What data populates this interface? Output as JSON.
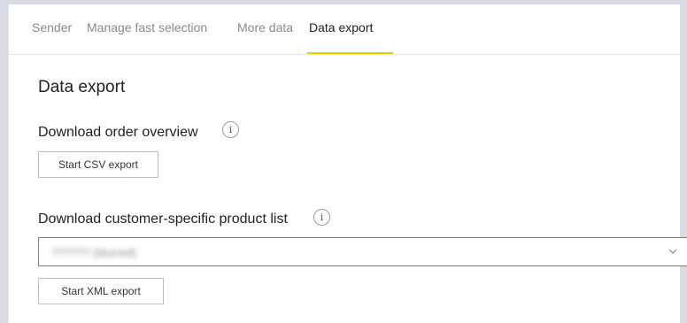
{
  "tabs": [
    {
      "label": "Sender",
      "active": false
    },
    {
      "label": "Manage fast selection",
      "active": false
    },
    {
      "label": "More data",
      "active": false
    },
    {
      "label": "Data export",
      "active": true
    }
  ],
  "page_title": "Data export",
  "order_overview": {
    "label": "Download order overview",
    "info_icon": "info-icon",
    "button_label": "Start CSV export"
  },
  "product_list": {
    "label": "Download customer-specific product list",
    "info_icon": "info-icon",
    "select_value": "?????? (blurred)",
    "chevron_icon": "chevron-down-icon",
    "button_label": "Start XML export"
  },
  "colors": {
    "active_tab_underline": "#f0c800",
    "background": "#d9dbe3"
  }
}
